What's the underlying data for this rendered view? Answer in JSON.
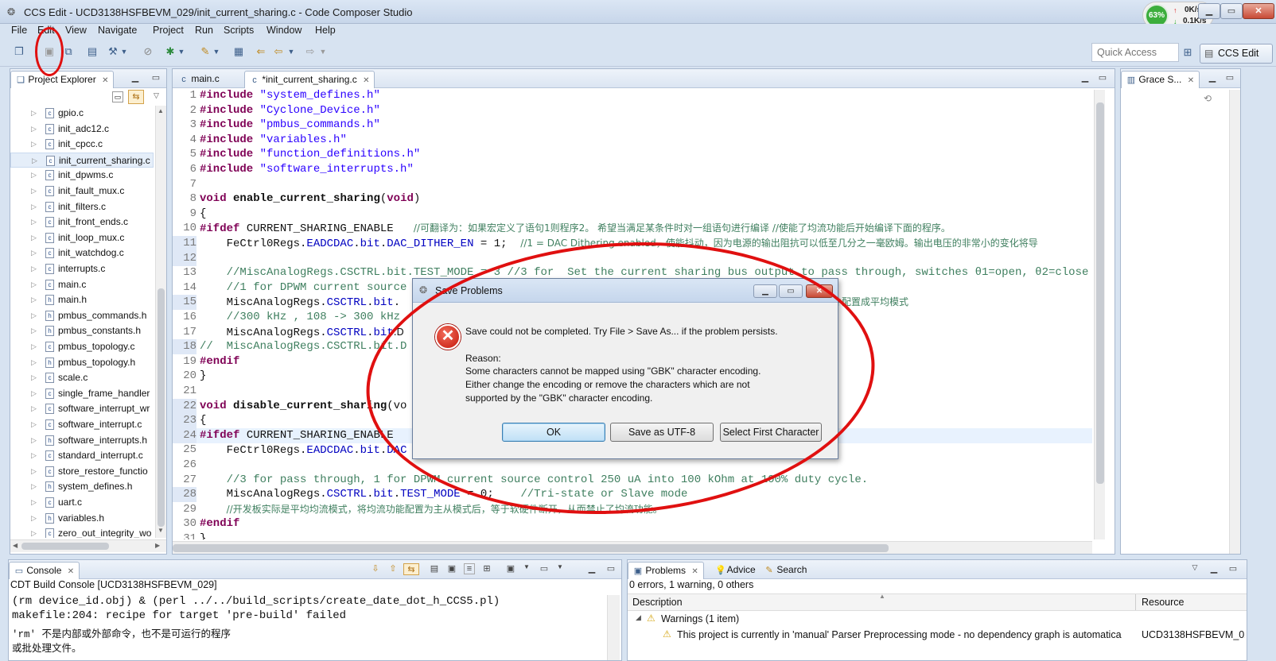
{
  "window": {
    "title": "CCS Edit - UCD3138HSFBEVM_029/init_current_sharing.c - Code Composer Studio",
    "net_percent": "63%",
    "net_up": "0K/s",
    "net_down": "0.1K/s"
  },
  "menu": [
    "File",
    "Edit",
    "View",
    "Navigate",
    "Project",
    "Run",
    "Scripts",
    "Window",
    "Help"
  ],
  "toolbar": {
    "quick_access_placeholder": "Quick Access",
    "perspective": "CCS Edit"
  },
  "project_explorer": {
    "tab": "Project Explorer",
    "files": [
      {
        "name": "gpio.c",
        "type": "c"
      },
      {
        "name": "init_adc12.c",
        "type": "c"
      },
      {
        "name": "init_cpcc.c",
        "type": "c"
      },
      {
        "name": "init_current_sharing.c",
        "type": "c",
        "selected": true
      },
      {
        "name": "init_dpwms.c",
        "type": "c"
      },
      {
        "name": "init_fault_mux.c",
        "type": "c"
      },
      {
        "name": "init_filters.c",
        "type": "c"
      },
      {
        "name": "init_front_ends.c",
        "type": "c"
      },
      {
        "name": "init_loop_mux.c",
        "type": "c"
      },
      {
        "name": "init_watchdog.c",
        "type": "c"
      },
      {
        "name": "interrupts.c",
        "type": "c"
      },
      {
        "name": "main.c",
        "type": "c"
      },
      {
        "name": "main.h",
        "type": "h"
      },
      {
        "name": "pmbus_commands.h",
        "type": "h"
      },
      {
        "name": "pmbus_constants.h",
        "type": "h"
      },
      {
        "name": "pmbus_topology.c",
        "type": "c"
      },
      {
        "name": "pmbus_topology.h",
        "type": "h"
      },
      {
        "name": "scale.c",
        "type": "c"
      },
      {
        "name": "single_frame_handler",
        "type": "c"
      },
      {
        "name": "software_interrupt_wr",
        "type": "c"
      },
      {
        "name": "software_interrupt.c",
        "type": "c"
      },
      {
        "name": "software_interrupts.h",
        "type": "h"
      },
      {
        "name": "standard_interrupt.c",
        "type": "c"
      },
      {
        "name": "store_restore_functio",
        "type": "c"
      },
      {
        "name": "system_defines.h",
        "type": "h"
      },
      {
        "name": "uart.c",
        "type": "c"
      },
      {
        "name": "variables.h",
        "type": "h"
      },
      {
        "name": "zero_out_integrity_wo",
        "type": "c"
      }
    ]
  },
  "editor": {
    "tabs": [
      {
        "label": "main.c",
        "active": false
      },
      {
        "label": "*init_current_sharing.c",
        "active": true
      }
    ],
    "lines": [
      {
        "n": "1",
        "parts": [
          [
            "kw",
            "#include "
          ],
          [
            "str",
            "\"system_defines.h\""
          ]
        ]
      },
      {
        "n": "2",
        "parts": [
          [
            "kw",
            "#include "
          ],
          [
            "str",
            "\"Cyclone_Device.h\""
          ]
        ]
      },
      {
        "n": "3",
        "parts": [
          [
            "kw",
            "#include "
          ],
          [
            "str",
            "\"pmbus_commands.h\""
          ]
        ]
      },
      {
        "n": "4",
        "parts": [
          [
            "kw",
            "#include "
          ],
          [
            "str",
            "\"variables.h\""
          ]
        ]
      },
      {
        "n": "5",
        "parts": [
          [
            "kw",
            "#include "
          ],
          [
            "str",
            "\"function_definitions.h\""
          ]
        ]
      },
      {
        "n": "6",
        "parts": [
          [
            "kw",
            "#include "
          ],
          [
            "str",
            "\"software_interrupts.h\""
          ]
        ]
      },
      {
        "n": "7",
        "parts": []
      },
      {
        "n": "8",
        "parts": [
          [
            "kw",
            "void "
          ],
          [
            "b",
            "enable_current_sharing"
          ],
          [
            "t",
            "("
          ],
          [
            "kw",
            "void"
          ],
          [
            "t",
            ")"
          ]
        ]
      },
      {
        "n": "9",
        "parts": [
          [
            "t",
            "{"
          ]
        ]
      },
      {
        "n": "10",
        "parts": [
          [
            "kw",
            "#ifdef "
          ],
          [
            "t",
            "CURRENT_SHARING_ENABLE   "
          ],
          [
            "cm",
            "//可翻译为：如果宏定义了语句1则程序2。 希望当满足某条件时对一组语句进行编译 //使能了均流功能后开始编译下面的程序。"
          ]
        ]
      },
      {
        "n": "11",
        "changed": true,
        "parts": [
          [
            "t",
            "    FeCtrl0Regs."
          ],
          [
            "fld",
            "EADCDAC"
          ],
          [
            "t",
            "."
          ],
          [
            "fld",
            "bit"
          ],
          [
            "t",
            "."
          ],
          [
            "fld",
            "DAC_DITHER_EN"
          ],
          [
            "t",
            " = 1;  "
          ],
          [
            "cm",
            "//1 = DAC Dithering enabled，使能抖动，因为电源的输出阻抗可以低至几分之一毫欧姆。输出电压的非常小的变化将导"
          ]
        ]
      },
      {
        "n": "12",
        "changed": true,
        "parts": []
      },
      {
        "n": "13",
        "parts": [
          [
            "t",
            "    "
          ],
          [
            "cm",
            "//MiscAnalogRegs.CSCTRL.bit.TEST_MODE = 3 //3 for  Set the current sharing bus output to pass through, switches θ1=open, θ2=close"
          ]
        ]
      },
      {
        "n": "14",
        "parts": [
          [
            "t",
            "    "
          ],
          [
            "cm",
            "//1 for DPWM current source"
          ]
        ]
      },
      {
        "n": "15",
        "changed": true,
        "parts": [
          [
            "t",
            "    MiscAnalogRegs."
          ],
          [
            "fld",
            "CSCTRL"
          ],
          [
            "t",
            "."
          ],
          [
            "fld",
            "bit"
          ],
          [
            "t",
            ".                                            "
          ],
          [
            "cm",
            "// average current Bus    软硬件配置成平均模式"
          ]
        ]
      },
      {
        "n": "16",
        "parts": [
          [
            "t",
            "    "
          ],
          [
            "cm",
            "//300 kHz , 108 -> 300 kHz"
          ]
        ]
      },
      {
        "n": "17",
        "parts": [
          [
            "t",
            "    MiscAnalogRegs."
          ],
          [
            "fld",
            "CSCTRL"
          ],
          [
            "t",
            "."
          ],
          [
            "fld",
            "bit"
          ],
          [
            "t",
            ".D                                            DPWM_PERIOD + 1 * LSB分辨率。LSB的分辨率等于DPWM"
          ]
        ]
      },
      {
        "n": "18",
        "changed": true,
        "parts": [
          [
            "cm",
            "//  MiscAnalogRegs.CSCTRL.bit.D"
          ]
        ]
      },
      {
        "n": "19",
        "parts": [
          [
            "kw",
            "#endif"
          ]
        ]
      },
      {
        "n": "20",
        "parts": [
          [
            "t",
            "}"
          ]
        ]
      },
      {
        "n": "21",
        "parts": []
      },
      {
        "n": "22",
        "changed": true,
        "parts": [
          [
            "kw",
            "void "
          ],
          [
            "b",
            "disable_current_sharing"
          ],
          [
            "t",
            "(vo"
          ]
        ]
      },
      {
        "n": "23",
        "changed": true,
        "parts": [
          [
            "t",
            "{"
          ]
        ]
      },
      {
        "n": "24",
        "changed": true,
        "hl": true,
        "parts": [
          [
            "kw",
            "#ifdef "
          ],
          [
            "t",
            "CURRENT_SHARING_ENABLE"
          ]
        ]
      },
      {
        "n": "25",
        "parts": [
          [
            "t",
            "    FeCtrl0Regs."
          ],
          [
            "fld",
            "EADCDAC"
          ],
          [
            "t",
            "."
          ],
          [
            "fld",
            "bit"
          ],
          [
            "t",
            "."
          ],
          [
            "fld",
            "DAC"
          ],
          [
            "t",
            "                                                      "
          ],
          [
            "cm",
            "抖动"
          ]
        ]
      },
      {
        "n": "26",
        "parts": []
      },
      {
        "n": "27",
        "parts": [
          [
            "t",
            "    "
          ],
          [
            "cm",
            "//3 for pass through, 1 for DPWM current source control 250 uA into 100 kOhm at 100% duty cycle."
          ]
        ]
      },
      {
        "n": "28",
        "changed": true,
        "parts": [
          [
            "t",
            "    MiscAnalogRegs."
          ],
          [
            "fld",
            "CSCTRL"
          ],
          [
            "t",
            "."
          ],
          [
            "fld",
            "bit"
          ],
          [
            "t",
            "."
          ],
          [
            "fld",
            "TEST_MODE"
          ],
          [
            "t",
            " = 0;    "
          ],
          [
            "cm",
            "//Tri-state or Slave mode"
          ]
        ]
      },
      {
        "n": "29",
        "parts": [
          [
            "t",
            "    "
          ],
          [
            "cm",
            "//开发板实际是平均均流模式，将均流功能配置为主从模式后，等于软硬件断开，从而禁止了均流功能。"
          ]
        ]
      },
      {
        "n": "30",
        "parts": [
          [
            "kw",
            "#endif"
          ]
        ]
      },
      {
        "n": "31",
        "parts": [
          [
            "t",
            "}"
          ]
        ]
      }
    ]
  },
  "grace": {
    "tab": "Grace S..."
  },
  "console": {
    "tab": "Console",
    "header": "CDT Build Console [UCD3138HSFBEVM_029]",
    "lines": [
      "(rm device_id.obj) & (perl ../../build_scripts/create_date_dot_h_CCS5.pl)",
      "makefile:204: recipe for target 'pre-build' failed",
      "'rm' 不是内部或外部命令，也不是可运行的程序",
      "或批处理文件。"
    ]
  },
  "problems": {
    "tabs": [
      "Problems",
      "Advice",
      "Search"
    ],
    "summary": "0 errors, 1 warning, 0 others",
    "columns": [
      "Description",
      "Resource"
    ],
    "group": "Warnings (1 item)",
    "item_description": "This project is currently in 'manual' Parser Preprocessing mode - no dependency graph is automatica",
    "item_resource": "UCD3138HSFBEVM_02"
  },
  "dialog": {
    "title": "Save Problems",
    "message": "Save could not be completed. Try File > Save As... if the problem persists.",
    "reason_label": "Reason:",
    "reason_lines": [
      "Some characters cannot be mapped using \"GBK\" character encoding.",
      "Either change the encoding or remove the characters which are not",
      "supported by the \"GBK\" character encoding."
    ],
    "buttons": {
      "ok": "OK",
      "utf8": "Save as UTF-8",
      "select": "Select First Character"
    }
  },
  "colors": {
    "annotation": "#e01010",
    "keyword": "#7f0055",
    "string": "#2a00ff",
    "comment": "#3f7f5f"
  }
}
